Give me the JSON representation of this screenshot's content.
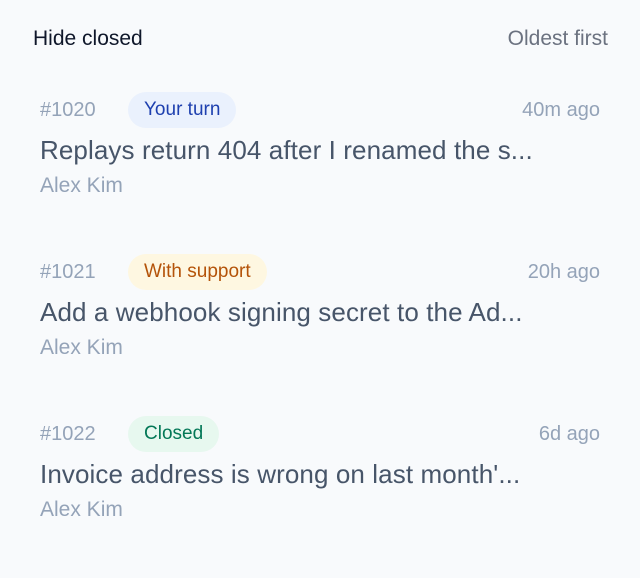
{
  "toolbar": {
    "hide_closed_label": "Hide closed",
    "sort_label": "Oldest first"
  },
  "tickets": [
    {
      "id": "#1020",
      "status": "Your turn",
      "time": "40m ago",
      "subject": "Replays return 404 after I renamed the s...",
      "author": "Alex Kim"
    },
    {
      "id": "#1021",
      "status": "With support",
      "time": "20h ago",
      "subject": "Add a webhook signing secret to the Ad...",
      "author": "Alex Kim"
    },
    {
      "id": "#1022",
      "status": "Closed",
      "time": "6d ago",
      "subject": "Invoice address is wrong on last month'...",
      "author": "Alex Kim"
    }
  ],
  "colors": {
    "background": "#f8fafc",
    "your_turn_bg": "#eaf1fd",
    "your_turn_text": "#1e40af",
    "with_support_bg": "#fef7e1",
    "with_support_text": "#b45309",
    "closed_bg": "#e7f8ef",
    "closed_text": "#047857"
  }
}
